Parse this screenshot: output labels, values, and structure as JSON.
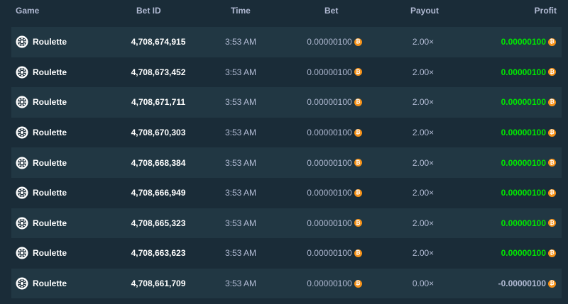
{
  "table": {
    "columns": {
      "game": "Game",
      "bet_id": "Bet ID",
      "time": "Time",
      "bet": "Bet",
      "payout": "Payout",
      "profit": "Profit"
    },
    "icons": {
      "game": "roulette-wheel-icon",
      "currency": "bitcoin-coin-icon"
    },
    "colors": {
      "background": "#1a2c38",
      "alt_row": "#213743",
      "profit_positive": "#00e701",
      "coin": "#f7931a"
    },
    "rows": [
      {
        "game": "Roulette",
        "bet_id": "4,708,674,915",
        "time": "3:53 AM",
        "bet": "0.00000100",
        "coin": "₿",
        "payout": "2.00×",
        "profit": "0.00000100",
        "win": true
      },
      {
        "game": "Roulette",
        "bet_id": "4,708,673,452",
        "time": "3:53 AM",
        "bet": "0.00000100",
        "coin": "₿",
        "payout": "2.00×",
        "profit": "0.00000100",
        "win": true
      },
      {
        "game": "Roulette",
        "bet_id": "4,708,671,711",
        "time": "3:53 AM",
        "bet": "0.00000100",
        "coin": "₿",
        "payout": "2.00×",
        "profit": "0.00000100",
        "win": true
      },
      {
        "game": "Roulette",
        "bet_id": "4,708,670,303",
        "time": "3:53 AM",
        "bet": "0.00000100",
        "coin": "₿",
        "payout": "2.00×",
        "profit": "0.00000100",
        "win": true
      },
      {
        "game": "Roulette",
        "bet_id": "4,708,668,384",
        "time": "3:53 AM",
        "bet": "0.00000100",
        "coin": "₿",
        "payout": "2.00×",
        "profit": "0.00000100",
        "win": true
      },
      {
        "game": "Roulette",
        "bet_id": "4,708,666,949",
        "time": "3:53 AM",
        "bet": "0.00000100",
        "coin": "₿",
        "payout": "2.00×",
        "profit": "0.00000100",
        "win": true
      },
      {
        "game": "Roulette",
        "bet_id": "4,708,665,323",
        "time": "3:53 AM",
        "bet": "0.00000100",
        "coin": "₿",
        "payout": "2.00×",
        "profit": "0.00000100",
        "win": true
      },
      {
        "game": "Roulette",
        "bet_id": "4,708,663,623",
        "time": "3:53 AM",
        "bet": "0.00000100",
        "coin": "₿",
        "payout": "2.00×",
        "profit": "0.00000100",
        "win": true
      },
      {
        "game": "Roulette",
        "bet_id": "4,708,661,709",
        "time": "3:53 AM",
        "bet": "0.00000100",
        "coin": "₿",
        "payout": "0.00×",
        "profit": "-0.00000100",
        "win": false
      }
    ]
  }
}
